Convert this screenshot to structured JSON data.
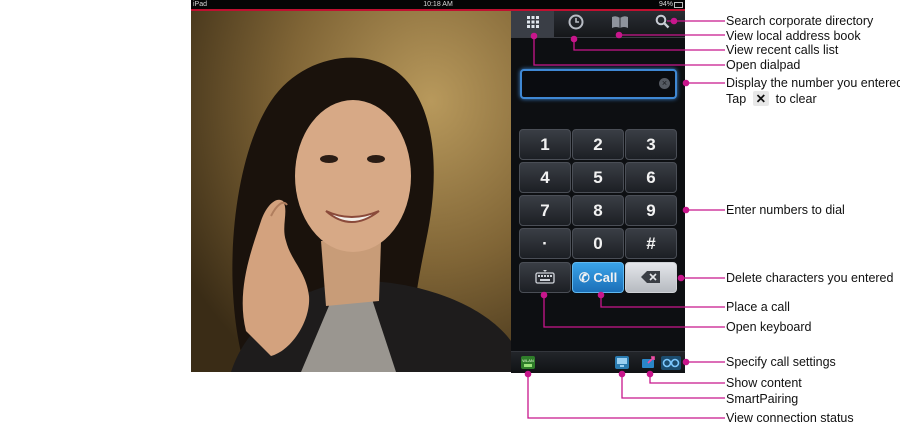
{
  "status_bar": {
    "device": "iPad",
    "time": "10:18 AM",
    "battery": "94%"
  },
  "number_field": {
    "value": ""
  },
  "keypad": {
    "keys": [
      "1",
      "2",
      "3",
      "4",
      "5",
      "6",
      "7",
      "8",
      "9",
      "·",
      "0",
      "#"
    ],
    "call_label": "Call"
  },
  "callouts": {
    "search_directory": "Search corporate directory",
    "address_book": "View local address book",
    "recent_calls": "View recent calls list",
    "open_dialpad": "Open dialpad",
    "display_number": "Display the number you entered",
    "tap_clear_prefix": "Tap",
    "tap_clear_suffix": "to clear",
    "enter_numbers": "Enter numbers to dial",
    "delete_chars": "Delete characters you entered",
    "place_call": "Place a call",
    "open_keyboard": "Open keyboard",
    "call_settings": "Specify call settings",
    "show_content": "Show content",
    "smartpairing": "SmartPairing",
    "connection_status": "View connection status"
  },
  "colors": {
    "callout_line": "#c8168c",
    "field_border": "#3f88d4",
    "call_button": "#2a8ad6"
  },
  "icons": [
    "dialpad-icon",
    "clock-icon",
    "book-icon",
    "search-icon",
    "keyboard-icon",
    "phone-icon",
    "backspace-icon",
    "wlan-icon",
    "smartpairing-icon",
    "share-content-icon",
    "settings-icon"
  ]
}
